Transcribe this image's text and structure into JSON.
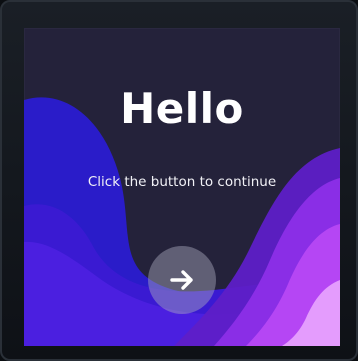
{
  "screen": {
    "title": "Hello",
    "subtitle": "Click the button to continue"
  },
  "continue_button": {
    "icon": "arrow-right-icon"
  },
  "colors": {
    "background": "#24223a",
    "wave_blue": "#2a1cc9",
    "wave_indigo": "#3314d6",
    "wave_purple": "#6a22d8",
    "wave_violet": "#a240f0",
    "wave_magenta": "#c14cf6",
    "wave_pink": "#e8a0ff",
    "button": "#a9a9bd"
  }
}
